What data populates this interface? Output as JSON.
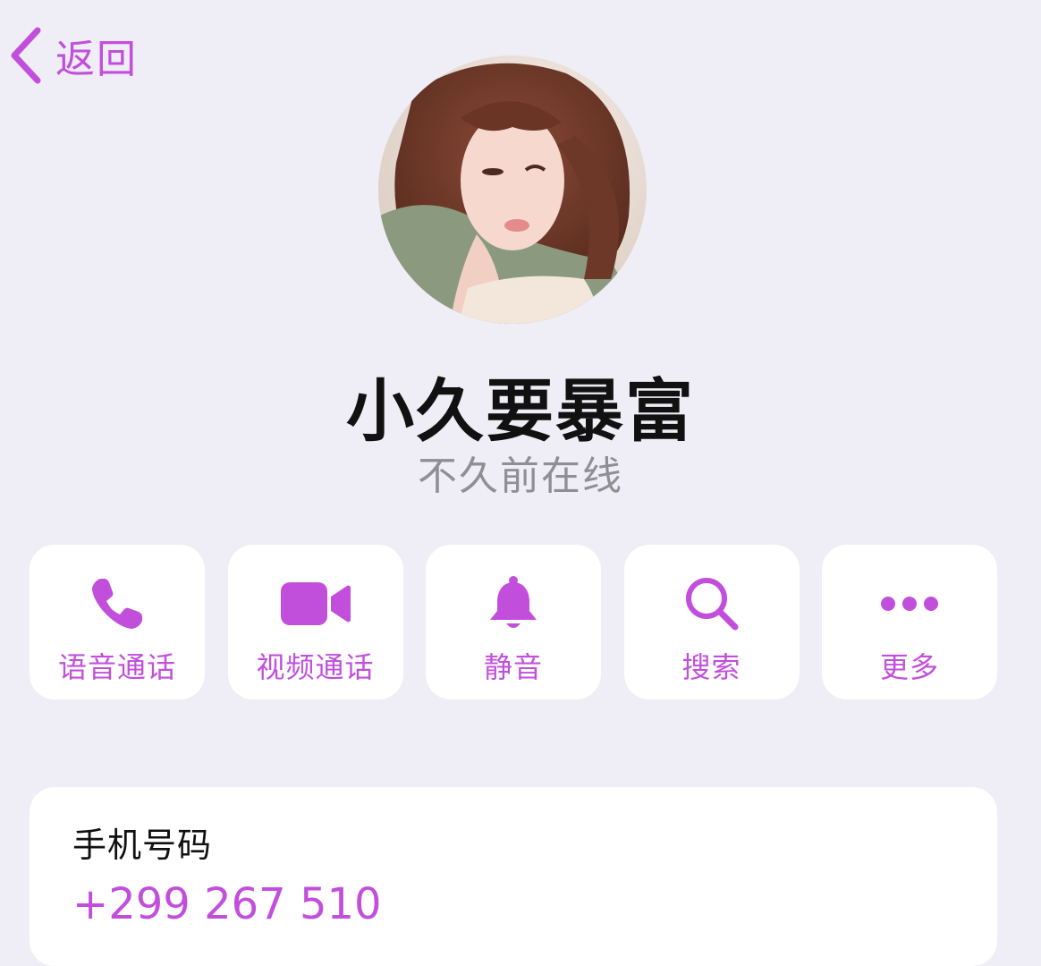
{
  "nav": {
    "back_label": "返回",
    "back_icon": "chevron-left-icon"
  },
  "profile": {
    "name": "小久要暴富",
    "status": "不久前在线",
    "avatar": "profile-photo"
  },
  "actions": [
    {
      "label": "语音通话",
      "icon": "phone-icon"
    },
    {
      "label": "视频通话",
      "icon": "video-camera-icon"
    },
    {
      "label": "静音",
      "icon": "bell-icon"
    },
    {
      "label": "搜索",
      "icon": "search-icon"
    },
    {
      "label": "更多",
      "icon": "more-dots-icon"
    }
  ],
  "info": {
    "phone_label": "手机号码",
    "phone_value": "+299 267 510"
  },
  "colors": {
    "accent": "#c24fdc",
    "background": "#efeef6",
    "card": "#ffffff",
    "secondary_text": "#8e8e93"
  }
}
